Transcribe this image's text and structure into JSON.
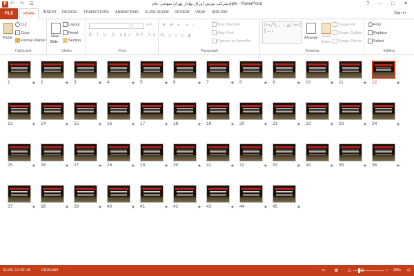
{
  "window": {
    "title": "شرکت بورس اوراق بهادار تهران سهامی عام.pptx - PowerPoint",
    "app_icon": "P",
    "qat": "↶ ↷ ☰",
    "controls": "? – □ ✕"
  },
  "tabs": {
    "file": "FILE",
    "home": "HOME",
    "items": [
      "INSERT",
      "DESIGN",
      "TRANSITIONS",
      "ANIMATIONS",
      "SLIDE SHOW",
      "REVIEW",
      "VIEW",
      "ADD-INS"
    ],
    "signin": "Sign in"
  },
  "ribbon": {
    "clipboard": {
      "label": "Clipboard",
      "paste": "Paste",
      "cut": "Cut",
      "copy": "Copy",
      "format_painter": "Format Painter"
    },
    "slides": {
      "label": "Slides",
      "new_slide": "New",
      "new_slide2": "Slide",
      "layout": "Layout",
      "reset": "Reset",
      "section": "Section"
    },
    "font": {
      "label": "Font"
    },
    "paragraph": {
      "label": "Paragraph",
      "text_direction": "Text Direction",
      "align_text": "Align Text",
      "convert": "Convert to SmartArt"
    },
    "drawing": {
      "label": "Drawing",
      "arrange": "Arrange",
      "quick_styles": "Quick",
      "quick_styles2": "Styles",
      "shape_fill": "Shape Fill",
      "shape_outline": "Shape Outline",
      "shape_effects": "Shape Effects",
      "shapes_glyphs": "□○╱╲→←△□▭⬡☆♡✩{ }→↓"
    },
    "editing": {
      "label": "Editing",
      "find": "Find",
      "replace": "Replace",
      "select": "Select"
    }
  },
  "slides": [
    {
      "n": "1"
    },
    {
      "n": "2"
    },
    {
      "n": "3"
    },
    {
      "n": "4"
    },
    {
      "n": "5"
    },
    {
      "n": "6"
    },
    {
      "n": "7"
    },
    {
      "n": "8"
    },
    {
      "n": "9"
    },
    {
      "n": "10"
    },
    {
      "n": "11"
    },
    {
      "n": "12"
    },
    {
      "n": "13"
    },
    {
      "n": "14"
    },
    {
      "n": "15"
    },
    {
      "n": "16"
    },
    {
      "n": "17"
    },
    {
      "n": "18"
    },
    {
      "n": "19"
    },
    {
      "n": "20"
    },
    {
      "n": "21"
    },
    {
      "n": "22"
    },
    {
      "n": "23"
    },
    {
      "n": "24"
    },
    {
      "n": "25"
    },
    {
      "n": "26"
    },
    {
      "n": "27"
    },
    {
      "n": "28"
    },
    {
      "n": "29"
    },
    {
      "n": "30"
    },
    {
      "n": "31"
    },
    {
      "n": "32"
    },
    {
      "n": "33"
    },
    {
      "n": "34"
    },
    {
      "n": "35"
    },
    {
      "n": "36"
    },
    {
      "n": "37"
    },
    {
      "n": "38"
    },
    {
      "n": "39"
    },
    {
      "n": "40"
    },
    {
      "n": "41"
    },
    {
      "n": "42"
    },
    {
      "n": "43"
    },
    {
      "n": "44"
    },
    {
      "n": "45"
    }
  ],
  "selected_slide": "12",
  "star_symbol": "★",
  "status": {
    "slide_info": "SLIDE 12 OF 45",
    "language": "PERSIAN",
    "zoom": "38%"
  },
  "colors": {
    "accent": "#c43e1c"
  }
}
